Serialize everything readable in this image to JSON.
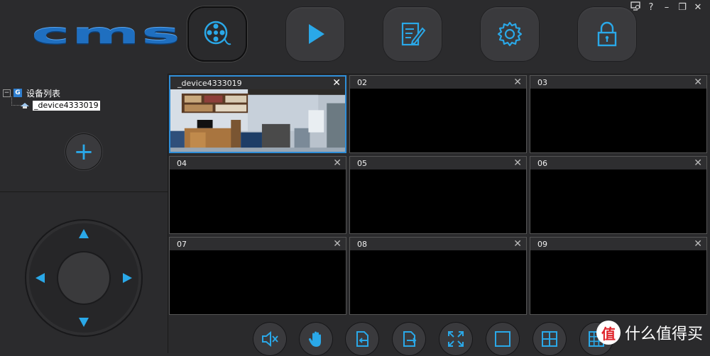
{
  "app": {
    "logo_text": "cms"
  },
  "window_controls": {
    "monitor_icon": "monitor-icon",
    "help": "?",
    "minimize": "–",
    "restore": "❐",
    "close": "✕"
  },
  "nav": [
    {
      "name": "live-view",
      "icon": "film-reel-icon",
      "active": true
    },
    {
      "name": "playback",
      "icon": "play-icon",
      "active": false
    },
    {
      "name": "log",
      "icon": "document-edit-icon",
      "active": false
    },
    {
      "name": "settings",
      "icon": "gear-icon",
      "active": false
    },
    {
      "name": "lock",
      "icon": "lock-icon",
      "active": false
    }
  ],
  "device_tree": {
    "root_label": "设备列表",
    "device_label": "_device4333019"
  },
  "grid": {
    "cells": [
      {
        "title": "_device4333019",
        "has_feed": true,
        "selected": true
      },
      {
        "title": "02",
        "has_feed": false,
        "selected": false
      },
      {
        "title": "03",
        "has_feed": false,
        "selected": false
      },
      {
        "title": "04",
        "has_feed": false,
        "selected": false
      },
      {
        "title": "05",
        "has_feed": false,
        "selected": false
      },
      {
        "title": "06",
        "has_feed": false,
        "selected": false
      },
      {
        "title": "07",
        "has_feed": false,
        "selected": false
      },
      {
        "title": "08",
        "has_feed": false,
        "selected": false
      },
      {
        "title": "09",
        "has_feed": false,
        "selected": false
      }
    ],
    "close_glyph": "✕"
  },
  "toolbar": [
    {
      "name": "mute",
      "icon": "speaker-mute-icon"
    },
    {
      "name": "ptz-hand",
      "icon": "hand-icon"
    },
    {
      "name": "previous-page",
      "icon": "page-prev-icon"
    },
    {
      "name": "next-page",
      "icon": "page-next-icon"
    },
    {
      "name": "fullscreen",
      "icon": "fullscreen-icon"
    },
    {
      "name": "layout-1",
      "icon": "single-square-icon"
    },
    {
      "name": "layout-4",
      "icon": "quad-grid-icon"
    },
    {
      "name": "layout-9",
      "icon": "nine-grid-icon"
    }
  ],
  "watermark": {
    "badge": "值",
    "text": "什么值得买"
  },
  "colors": {
    "accent": "#2aa8e8",
    "selected_border": "#2f8ed8",
    "background": "#2a2a2c"
  }
}
